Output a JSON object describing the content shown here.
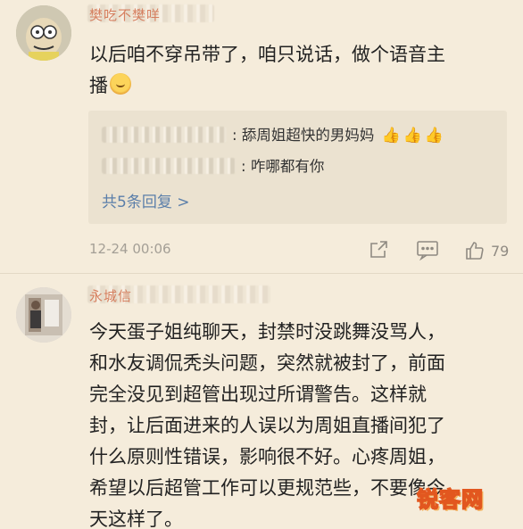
{
  "comments": [
    {
      "username": "樊吃不樊咩",
      "content_lines": [
        "以后咱不穿吊带了，咱只说话，做个语音主",
        "播"
      ],
      "replies": [
        {
          "author": "Gion Di Coole",
          "text": "舔周姐超快的男妈妈",
          "thumbs": [
            "👍",
            "👍",
            "👍"
          ]
        },
        {
          "author": "温",
          "text": "咋哪都有你"
        }
      ],
      "more_replies": "共5条回复 >",
      "timestamp": "12-24 00:06",
      "likes": "79"
    },
    {
      "username": "永城信",
      "content_lines": [
        "今天蛋子姐纯聊天，封禁时没跳舞没骂人，",
        "和水友调侃秃头问题，突然就被封了，前面",
        "完全没见到超管出现过所谓警告。这样就",
        "封，让后面进来的人误以为周姐直播间犯了",
        "什么原则性错误，影响很不好。心疼周姐，",
        "希望以后超管工作可以更规范些，不要像今",
        "天这样了。"
      ]
    }
  ],
  "icons": {
    "emoji": "shy-face-emoji",
    "share": "share-icon",
    "comment": "comment-icon",
    "like": "thumbs-up-icon"
  },
  "watermark": "锐客网",
  "colors": {
    "background": "#f5ecdb",
    "reply_box": "#ebe2d0",
    "link": "#5b7faa",
    "meta": "#a49f96",
    "username": "#d26d4a"
  }
}
